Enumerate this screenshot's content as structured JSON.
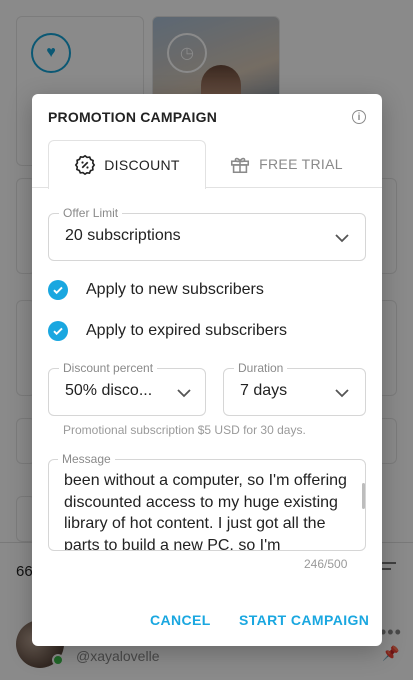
{
  "background": {
    "count_text": "66",
    "username": "@xayalovelle"
  },
  "dialog": {
    "title": "PROMOTION CAMPAIGN",
    "info_icon": "info-icon",
    "tabs": [
      {
        "label": "DISCOUNT",
        "icon": "discount-badge-icon",
        "active": true
      },
      {
        "label": "FREE TRIAL",
        "icon": "gift-icon",
        "active": false
      }
    ],
    "offer_limit": {
      "label": "Offer Limit",
      "value": "20 subscriptions"
    },
    "checkboxes": [
      {
        "label": "Apply to new subscribers",
        "checked": true
      },
      {
        "label": "Apply to expired subscribers",
        "checked": true
      }
    ],
    "discount_percent": {
      "label": "Discount percent",
      "value": "50% disco..."
    },
    "duration": {
      "label": "Duration",
      "value": "7 days"
    },
    "helper_text": "Promotional subscription $5 USD for 30 days.",
    "message": {
      "label": "Message",
      "value": "been without a computer, so I'm offering discounted access to my huge existing library of hot content. I just got all the parts to build a new PC, so I'm"
    },
    "char_counter": "246/500",
    "buttons": {
      "cancel": "CANCEL",
      "start": "START CAMPAIGN"
    },
    "accent_color": "#1aa7e0"
  }
}
